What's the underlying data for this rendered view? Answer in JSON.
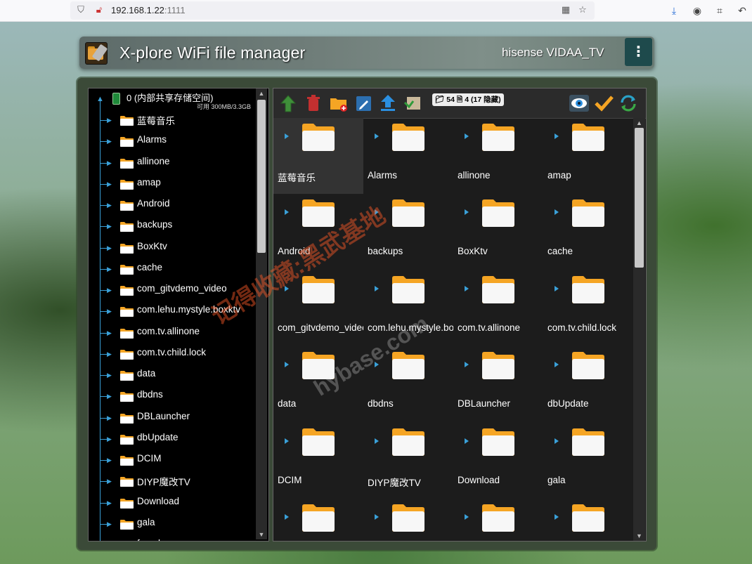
{
  "browser": {
    "url_host": "192.168.1.22",
    "url_port": ":1111"
  },
  "header": {
    "app_title": "X-plore WiFi file manager",
    "device_name": "hisense VIDAA_TV",
    "menu_icon": "⋮"
  },
  "tree": {
    "root_label": "0 (内部共享存储空间)",
    "root_sub": "可用 300MB/3.3GB",
    "items": [
      "蓝莓音乐",
      "Alarms",
      "allinone",
      "amap",
      "Android",
      "backups",
      "BoxKtv",
      "cache",
      "com_gitvdemo_video",
      "com.lehu.mystyle.boxktv",
      "com.tv.allinone",
      "com.tv.child.lock",
      "data",
      "dbdns",
      "DBLauncher",
      "dbUpdate",
      "DCIM",
      "DIYP魔改TV",
      "Download",
      "gala",
      "fused"
    ]
  },
  "toolbar": {
    "folder_count": "54",
    "file_count": "4",
    "hidden_text": "(17 隐藏)",
    "colors": {
      "accent": "#3aa0d8",
      "folder": "#f5a524",
      "check": "#f5a524"
    }
  },
  "files": {
    "items": [
      "蓝莓音乐",
      "Alarms",
      "allinone",
      "amap",
      "Android",
      "backups",
      "BoxKtv",
      "cache",
      "com_gitvdemo_video",
      "com.lehu.mystyle.boxktv",
      "com.tv.allinone",
      "com.tv.child.lock",
      "data",
      "dbdns",
      "DBLauncher",
      "dbUpdate",
      "DCIM",
      "DIYP魔改TV",
      "Download",
      "gala",
      "",
      "",
      "",
      ""
    ]
  },
  "watermark": {
    "line1": "记得收藏:黑武基地",
    "line2": "hybase.com"
  }
}
